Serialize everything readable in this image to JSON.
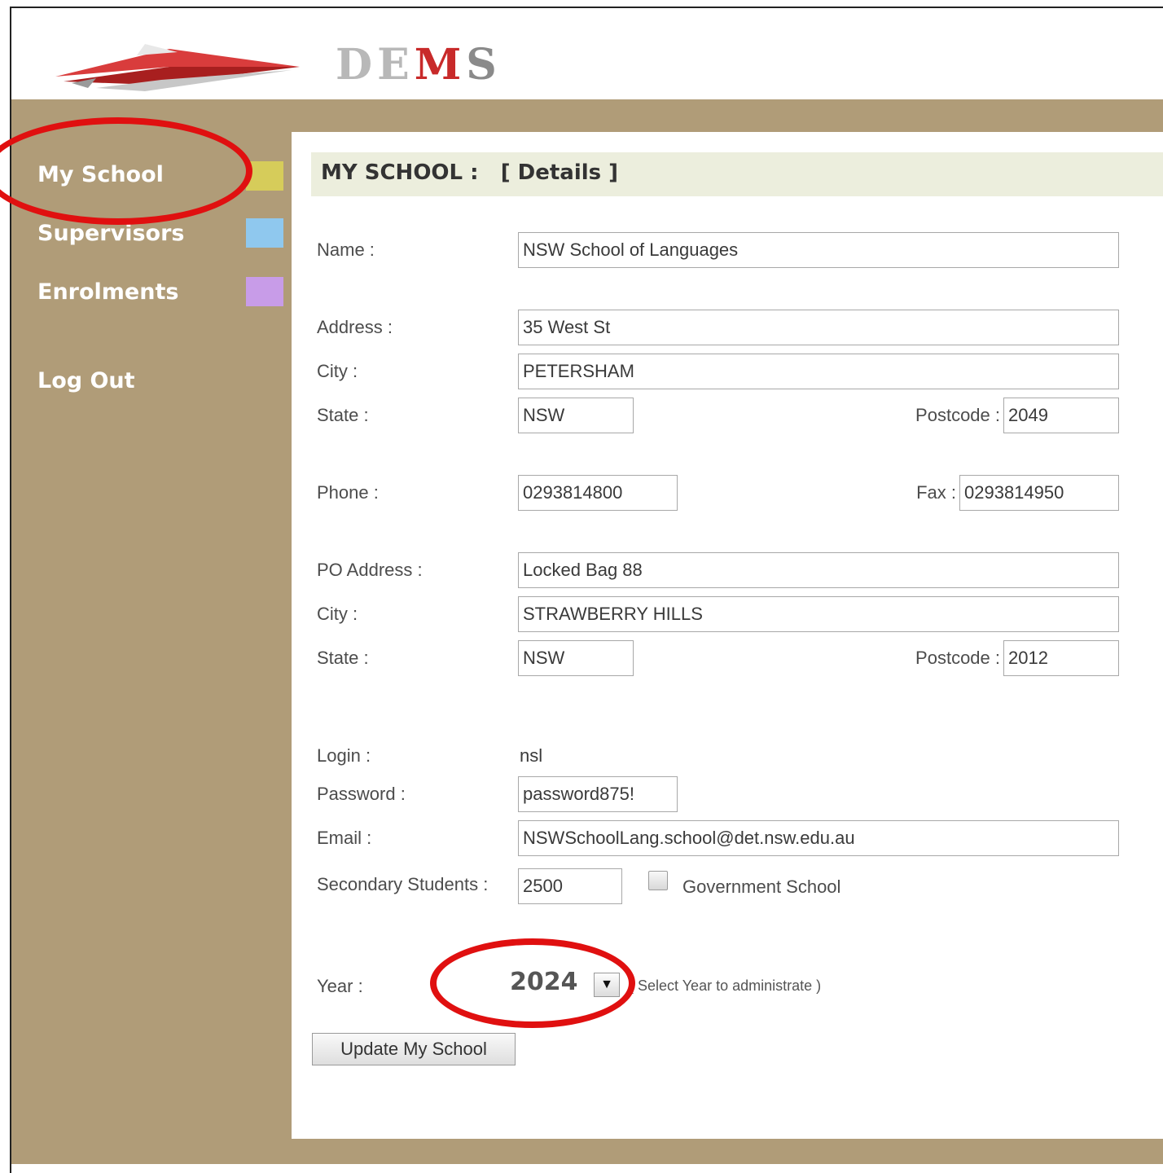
{
  "app": {
    "logo_text": "DEMS",
    "logo_parts": [
      "DE",
      "M",
      "S"
    ]
  },
  "sidebar": {
    "items": [
      {
        "label": "My School",
        "swatch": "#d6cc5a"
      },
      {
        "label": "Supervisors",
        "swatch": "#8fc8ee"
      },
      {
        "label": "Enrolments",
        "swatch": "#c89ce8"
      },
      {
        "label": "Log Out"
      }
    ]
  },
  "panel": {
    "title": "MY SCHOOL :   [ Details ]"
  },
  "form": {
    "name_label": "Name :",
    "name_value": "NSW School of Languages",
    "address_label": "Address :",
    "address_value": "35 West St",
    "city_label": "City :",
    "city_value": "PETERSHAM",
    "state_label": "State :",
    "state_value": "NSW",
    "postcode_label": "Postcode :",
    "postcode_value": "2049",
    "phone_label": "Phone :",
    "phone_value": "0293814800",
    "fax_label": "Fax :",
    "fax_value": "0293814950",
    "po_address_label": "PO Address :",
    "po_address_value": "Locked Bag 88",
    "po_city_label": "City :",
    "po_city_value": "STRAWBERRY HILLS",
    "po_state_label": "State :",
    "po_state_value": "NSW",
    "po_postcode_label": "Postcode :",
    "po_postcode_value": "2012",
    "login_label": "Login :",
    "login_value": "nsl",
    "password_label": "Password :",
    "password_value": "password875!",
    "email_label": "Email :",
    "email_value": "NSWSchoolLang.school@det.nsw.edu.au",
    "secondary_label": "Secondary Students :",
    "secondary_value": "2500",
    "government_label": "Government School",
    "government_checked": false,
    "year_label": "Year :",
    "year_value": "2024",
    "year_hint": "( Select Year to administrate )",
    "update_button": "Update My School"
  },
  "colors": {
    "sidebar_bg": "#b09c78",
    "panel_header_bg": "#eceedd",
    "annotation": "#e01010"
  }
}
